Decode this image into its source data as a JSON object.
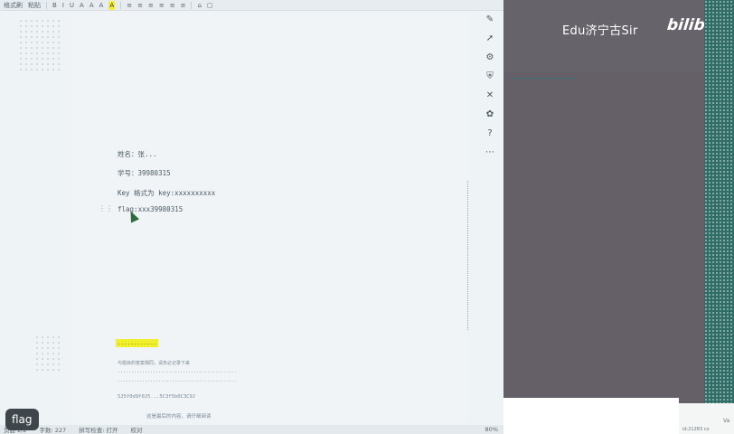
{
  "toolbar": {
    "items": [
      "格式刷",
      "粘贴",
      "B",
      "I",
      "U",
      "A",
      "A",
      "A",
      "A",
      "≡",
      "≡",
      "≡",
      "≡",
      "≡",
      "≡",
      "⌂",
      "▢"
    ]
  },
  "document": {
    "lines": [
      "姓名：张...",
      "学号：39980315",
      "Key 格式为 key:xxxxxxxxxx",
      "flag:xxx39980315"
    ],
    "highlight_text": "............",
    "footer_lines": [
      "与题目的答案相同，请务必记录下来",
      "............................................",
      "............................................"
    ],
    "code_line": "5J5f0d9f0J5...5C3f5b0C3C9J",
    "last_line": "这是最后的内容，请仔细阅读"
  },
  "statusbar": {
    "page": "页面 2/2",
    "words": "字数: 227",
    "spell": "拼写检查: 打开",
    "mode": "校对",
    "zoom": "80%"
  },
  "flag_button": "flag",
  "side_panel": {
    "brand": "Edu济宁古Sir",
    "logo": "bilibili",
    "corner_note": "id:21283 co",
    "corner_va": "Va"
  },
  "rail_icons": [
    "pen-icon",
    "cursor-icon",
    "settings-icon",
    "shield-icon",
    "tool-icon",
    "plugin-icon",
    "help-icon",
    "more-icon"
  ]
}
